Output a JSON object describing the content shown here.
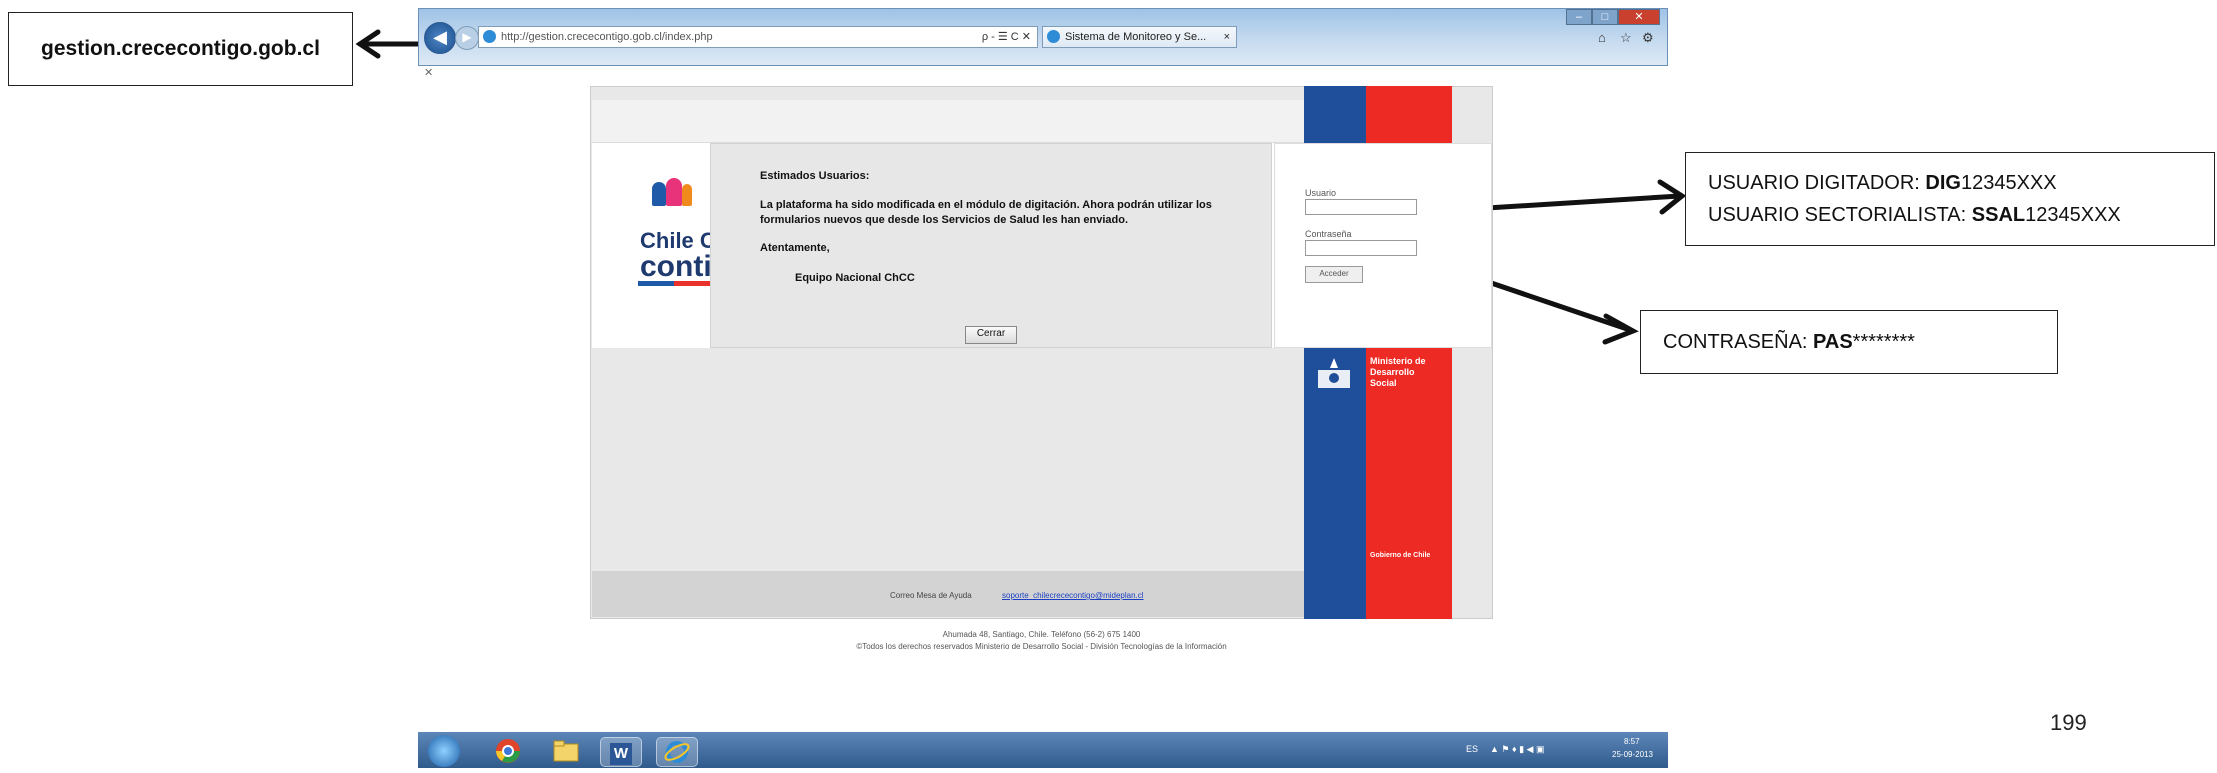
{
  "callouts": {
    "url": "gestion.crececontigo.gob.cl",
    "usuario_line1_prefix": "USUARIO DIGITADOR: ",
    "usuario_line1_bold": "DIG",
    "usuario_line1_suffix": "12345XXX",
    "usuario_line2_prefix": "USUARIO SECTORIALISTA: ",
    "usuario_line2_bold": "SSAL",
    "usuario_line2_suffix": "12345XXX",
    "contrasena_prefix": "CONTRASEÑA: ",
    "contrasena_bold": "PAS",
    "contrasena_suffix": "********"
  },
  "page_number": "199",
  "browser": {
    "address": "http://gestion.crececontigo.gob.cl/index.php",
    "search_controls": "ρ - ☰ C ✕",
    "tab_title": "Sistema de Monitoreo y Se...",
    "tab_close": "×",
    "window_controls": [
      "–",
      "□",
      "✕"
    ],
    "toolbar_icons": [
      "⌂",
      "☆",
      "⚙"
    ]
  },
  "dialog": {
    "greeting": "Estimados Usuarios:",
    "body": "La plataforma ha sido modificada en el módulo de digitación. Ahora podrán utilizar los formularios nuevos que desde los Servicios de Salud les han enviado.",
    "closing": "Atentamente,",
    "signature": "Equipo Nacional ChCC",
    "close_button": "Cerrar"
  },
  "login": {
    "user_label": "Usuario",
    "password_label": "Contraseña",
    "submit": "Acceder"
  },
  "logo": {
    "line1": "Chile CRE",
    "line2": "conti"
  },
  "ministry": {
    "name": "Ministerio de Desarrollo Social",
    "gov": "Gobierno de Chile"
  },
  "footer": {
    "help_label": "Correo Mesa de Ayuda",
    "help_link": "soporte_chilecrececontigo@mideplan.cl",
    "address": "Ahumada 48, Santiago, Chile. Teléfono (56-2) 675 1400",
    "rights": "©Todos los derechos reservados Ministerio de Desarrollo Social - División Tecnologías de la Información"
  },
  "taskbar": {
    "lang": "ES",
    "time": "8:57",
    "date": "25-09-2013"
  },
  "colors": {
    "chile_blue": "#1f4e9a",
    "chile_red": "#ee2a24",
    "link": "#1a3fc2"
  }
}
